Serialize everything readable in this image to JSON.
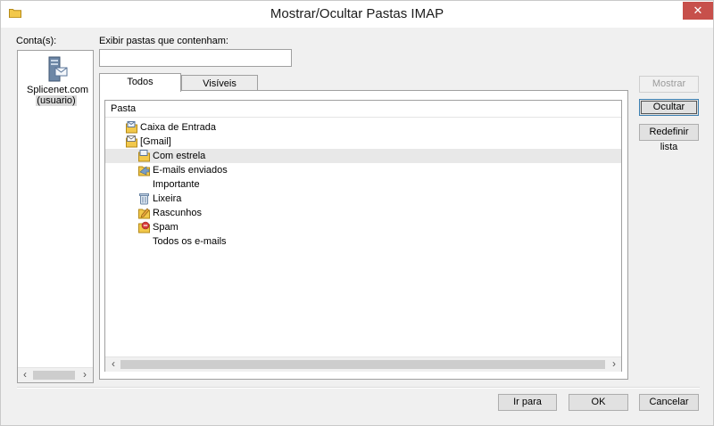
{
  "window": {
    "title": "Mostrar/Ocultar Pastas IMAP",
    "close_label": "✕"
  },
  "accounts": {
    "label": "Conta(s):",
    "items": [
      {
        "name": "Splicenet.com",
        "sub": "(usuario)",
        "icon": "mail-server-icon"
      }
    ]
  },
  "filter": {
    "label": "Exibir pastas que contenham:",
    "value": "",
    "placeholder": ""
  },
  "tabs": [
    {
      "label": "Todos",
      "active": true
    },
    {
      "label": "Visíveis",
      "active": false
    }
  ],
  "tree": {
    "header": "Pasta",
    "rows": [
      {
        "label": "Caixa de Entrada",
        "icon": "inbox-folder-icon",
        "level": 0,
        "selected": false
      },
      {
        "label": "[Gmail]",
        "icon": "mail-folder-icon",
        "level": 0,
        "selected": false
      },
      {
        "label": "Com estrela",
        "icon": "starred-folder-icon",
        "level": 1,
        "selected": true
      },
      {
        "label": "E-mails enviados",
        "icon": "sent-folder-icon",
        "level": 1,
        "selected": false
      },
      {
        "label": "Importante",
        "icon": "",
        "level": 1,
        "selected": false
      },
      {
        "label": "Lixeira",
        "icon": "trash-icon",
        "level": 1,
        "selected": false
      },
      {
        "label": "Rascunhos",
        "icon": "drafts-folder-icon",
        "level": 1,
        "selected": false
      },
      {
        "label": "Spam",
        "icon": "spam-folder-icon",
        "level": 1,
        "selected": false
      },
      {
        "label": "Todos os e-mails",
        "icon": "",
        "level": 1,
        "selected": false
      }
    ]
  },
  "side_buttons": {
    "mostrar": "Mostrar",
    "ocultar": "Ocultar",
    "redefinir": "Redefinir lista"
  },
  "footer_buttons": {
    "ir_para": "Ir para",
    "ok": "OK",
    "cancelar": "Cancelar"
  },
  "colors": {
    "close_button": "#c7504b",
    "selection": "#e8e8e8",
    "dialog_bg": "#f0f0f0"
  }
}
